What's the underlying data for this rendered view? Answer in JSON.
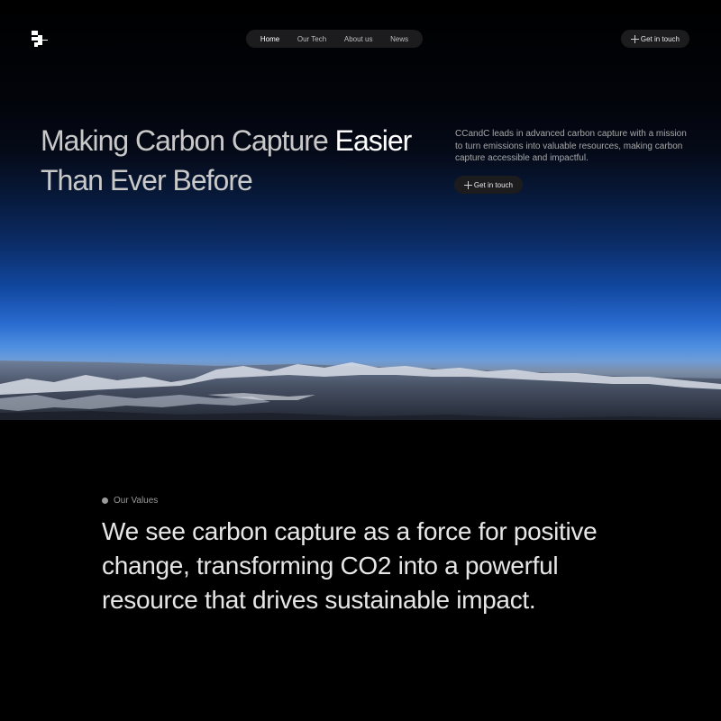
{
  "nav": {
    "items": [
      {
        "label": "Home",
        "active": true
      },
      {
        "label": "Our Tech",
        "active": false
      },
      {
        "label": "About us",
        "active": false
      },
      {
        "label": "News",
        "active": false
      }
    ]
  },
  "header": {
    "cta_label": "Get in touch"
  },
  "hero": {
    "headline_part1": "Making Carbon Capture ",
    "headline_highlight": "Easier",
    "headline_part2": "Than Ever Before",
    "intro": "CCandC leads in advanced carbon capture with a mission to turn emissions into valuable resources, making carbon capture accessible and impactful.",
    "cta_label": "Get in touch"
  },
  "values": {
    "tag": "Our Values",
    "text": "We see carbon capture as a force for positive change, transforming CO2 into a powerful resource that drives sustainable impact."
  },
  "colors": {
    "background": "#000000",
    "pill": "#1c1c1e",
    "headline_dim": "#c9c9c9",
    "headline_bright": "#ffffff"
  }
}
